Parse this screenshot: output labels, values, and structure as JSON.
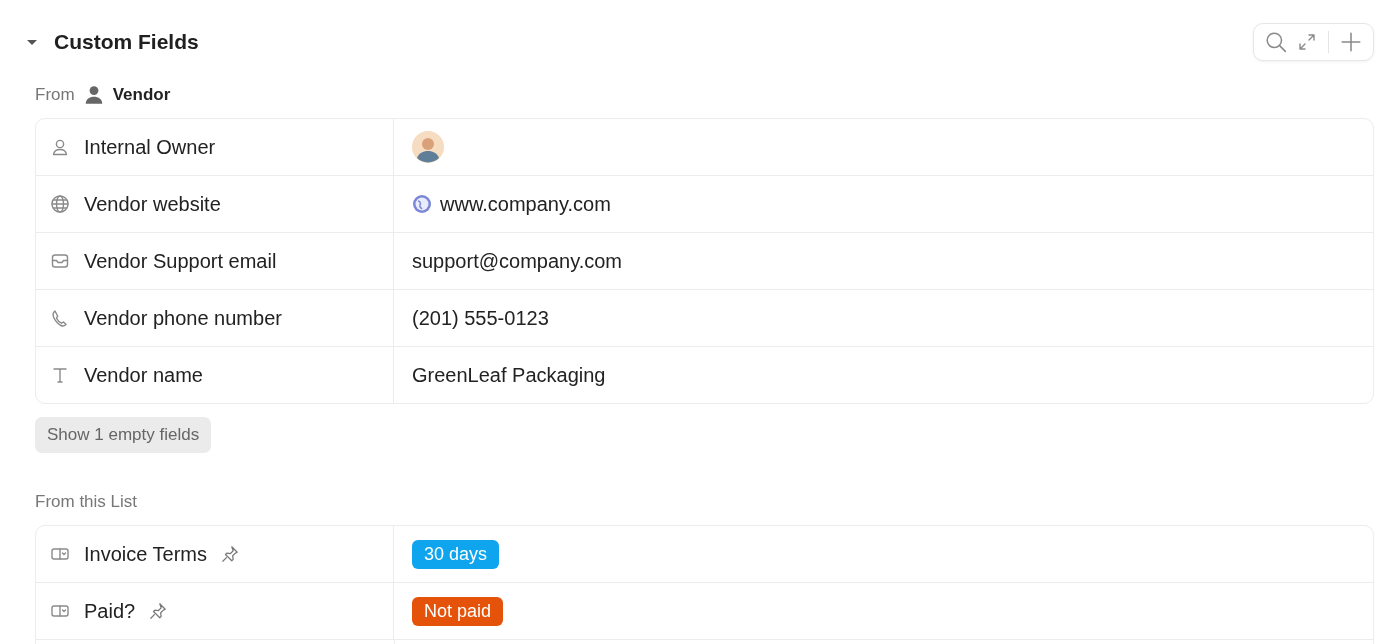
{
  "section": {
    "title": "Custom Fields",
    "expanded": true
  },
  "groups": [
    {
      "label": "From",
      "source": {
        "name": "Vendor"
      },
      "rows": [
        {
          "name": "Internal Owner",
          "pinned": false,
          "kind": "avatar"
        },
        {
          "name": "Vendor website",
          "pinned": false,
          "kind": "link",
          "value": "www.company.com"
        },
        {
          "name": "Vendor Support email",
          "pinned": false,
          "kind": "text",
          "value": "support@company.com"
        },
        {
          "name": "Vendor phone number",
          "pinned": false,
          "kind": "text",
          "value": "(201) 555-0123"
        },
        {
          "name": "Vendor name",
          "pinned": false,
          "kind": "text",
          "value": "GreenLeaf Packaging"
        }
      ],
      "more_button": "Show 1 empty fields"
    },
    {
      "label": "From this List",
      "rows": [
        {
          "name": "Invoice Terms",
          "pinned": true,
          "kind": "tag",
          "value": "30 days",
          "color": "#0ea5ee"
        },
        {
          "name": "Paid?",
          "pinned": true,
          "kind": "tag",
          "value": "Not paid",
          "color": "#e5530a"
        }
      ]
    }
  ]
}
